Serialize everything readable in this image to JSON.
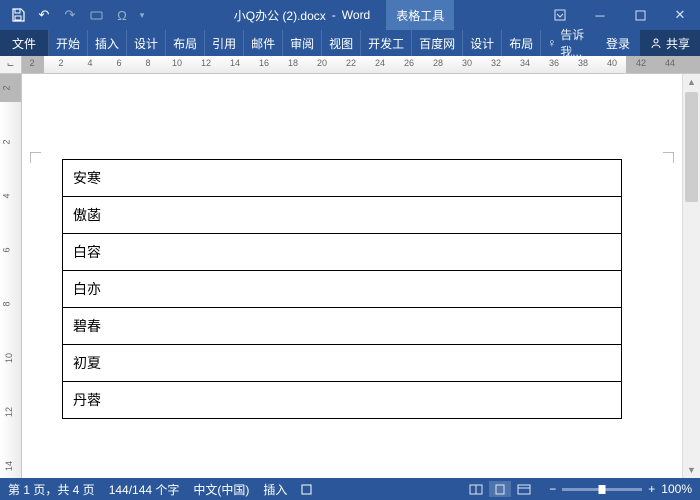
{
  "title": {
    "doc": "小Q办公 (2).docx",
    "app": "Word",
    "context_tab": "表格工具"
  },
  "qat": [
    "save",
    "undo",
    "redo",
    "touch",
    "omega"
  ],
  "ribbon": {
    "file": "文件",
    "tabs": [
      "开始",
      "插入",
      "设计",
      "布局",
      "引用",
      "邮件",
      "审阅",
      "视图",
      "开发工",
      "百度网"
    ],
    "context_tabs": [
      "设计",
      "布局"
    ],
    "tell": "告诉我...",
    "login": "登录",
    "share": "共享"
  },
  "hruler": {
    "dark_left_end": 22,
    "dark_right_start": 604,
    "nums": [
      2,
      2,
      4,
      6,
      8,
      10,
      12,
      14,
      16,
      18,
      20,
      22,
      24,
      26,
      28,
      30,
      32,
      34,
      36,
      38,
      40,
      42,
      44
    ]
  },
  "vruler": {
    "nums": [
      2,
      2,
      4,
      6,
      8,
      10,
      12,
      14
    ]
  },
  "table": {
    "rows": [
      "安寒",
      "傲菡",
      "白容",
      "白亦",
      "碧春",
      "初夏",
      "丹蓉"
    ]
  },
  "status": {
    "page": "第 1 页，共 4 页",
    "words": "144/144 个字",
    "lang": "中文(中国)",
    "insert": "插入",
    "overtype_icon": "",
    "zoom": "100%"
  }
}
